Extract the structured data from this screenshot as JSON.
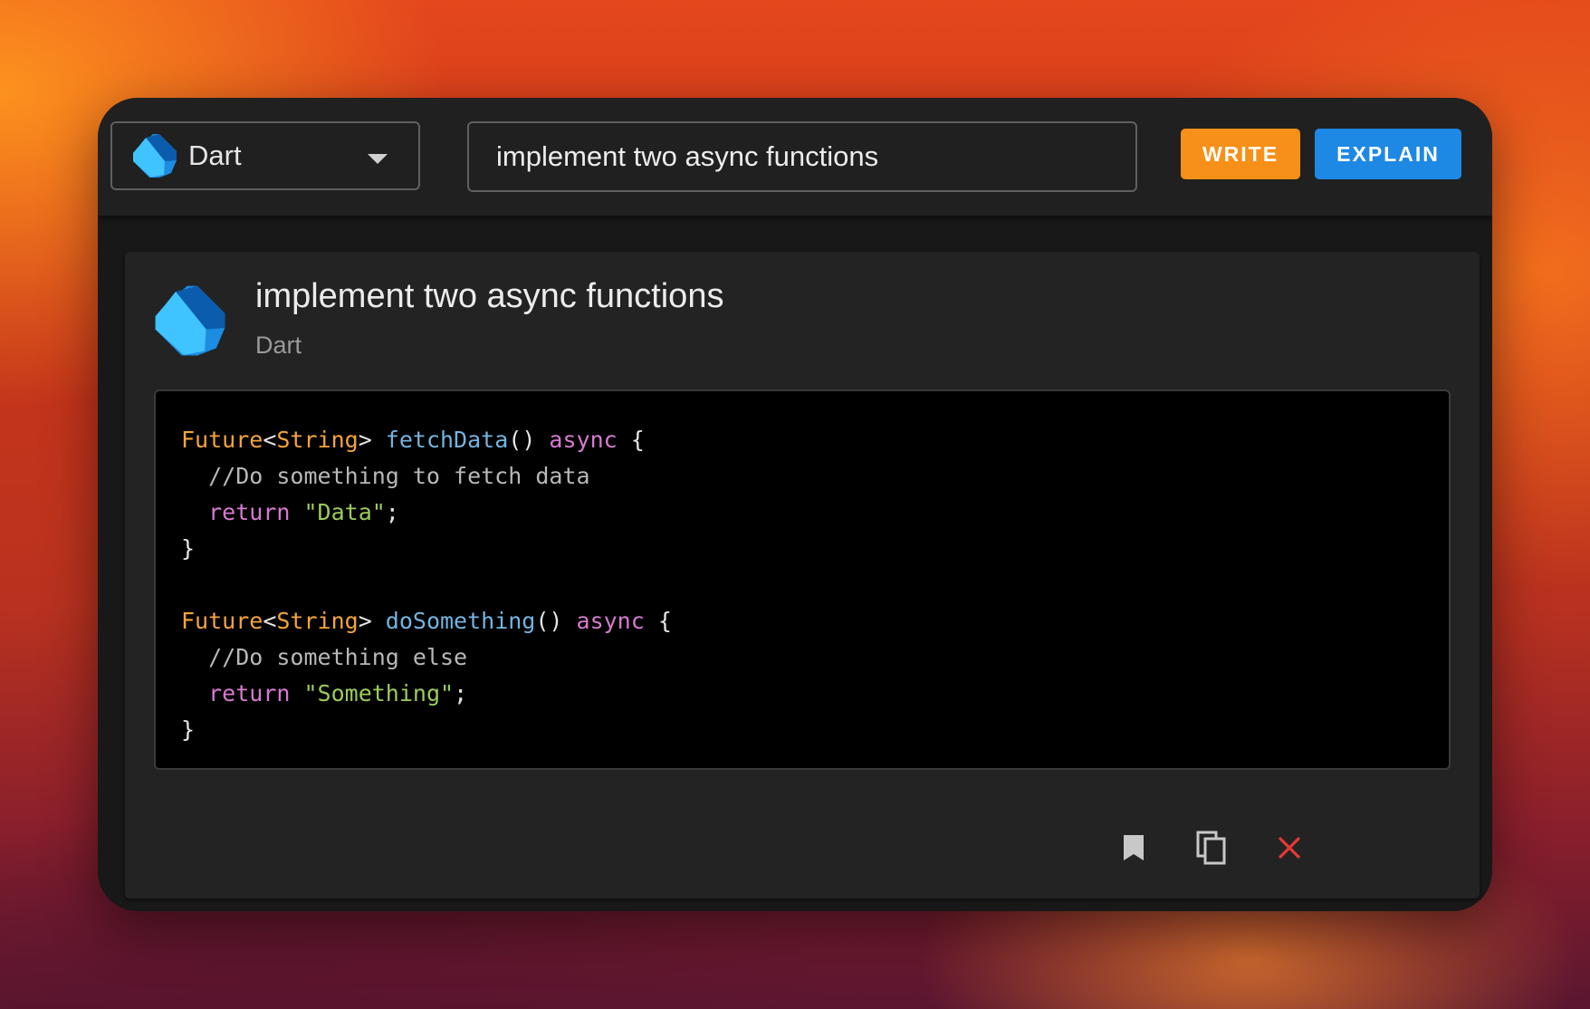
{
  "toolbar": {
    "language": "Dart",
    "prompt_value": "implement two async functions",
    "write_label": "WRITE",
    "explain_label": "EXPLAIN"
  },
  "card": {
    "title": "implement two async functions",
    "subtitle": "Dart",
    "code_lines": [
      [
        {
          "t": "type",
          "v": "Future"
        },
        {
          "t": "plain",
          "v": "<"
        },
        {
          "t": "type",
          "v": "String"
        },
        {
          "t": "plain",
          "v": "> "
        },
        {
          "t": "fn",
          "v": "fetchData"
        },
        {
          "t": "plain",
          "v": "() "
        },
        {
          "t": "kw",
          "v": "async"
        },
        {
          "t": "plain",
          "v": " {"
        }
      ],
      [
        {
          "t": "cmt",
          "v": "  //Do something to fetch data"
        }
      ],
      [
        {
          "t": "plain",
          "v": "  "
        },
        {
          "t": "kw",
          "v": "return"
        },
        {
          "t": "plain",
          "v": " "
        },
        {
          "t": "str",
          "v": "\"Data\""
        },
        {
          "t": "plain",
          "v": ";"
        }
      ],
      [
        {
          "t": "plain",
          "v": "}"
        }
      ],
      [
        {
          "t": "plain",
          "v": ""
        }
      ],
      [
        {
          "t": "type",
          "v": "Future"
        },
        {
          "t": "plain",
          "v": "<"
        },
        {
          "t": "type",
          "v": "String"
        },
        {
          "t": "plain",
          "v": "> "
        },
        {
          "t": "fn",
          "v": "doSomething"
        },
        {
          "t": "plain",
          "v": "() "
        },
        {
          "t": "kw",
          "v": "async"
        },
        {
          "t": "plain",
          "v": " {"
        }
      ],
      [
        {
          "t": "cmt",
          "v": "  //Do something else"
        }
      ],
      [
        {
          "t": "plain",
          "v": "  "
        },
        {
          "t": "kw",
          "v": "return"
        },
        {
          "t": "plain",
          "v": " "
        },
        {
          "t": "str",
          "v": "\"Something\""
        },
        {
          "t": "plain",
          "v": ";"
        }
      ],
      [
        {
          "t": "plain",
          "v": "}"
        }
      ]
    ],
    "actions": [
      {
        "name": "bookmark",
        "icon": "bookmark-icon"
      },
      {
        "name": "copy",
        "icon": "copy-icon"
      },
      {
        "name": "close",
        "icon": "close-icon"
      }
    ]
  },
  "colors": {
    "write_button": "#f79018",
    "explain_button": "#1e88e5",
    "close_icon": "#e53935",
    "dart_light": "#40c4ff",
    "dart_dark": "#0b5cad"
  }
}
